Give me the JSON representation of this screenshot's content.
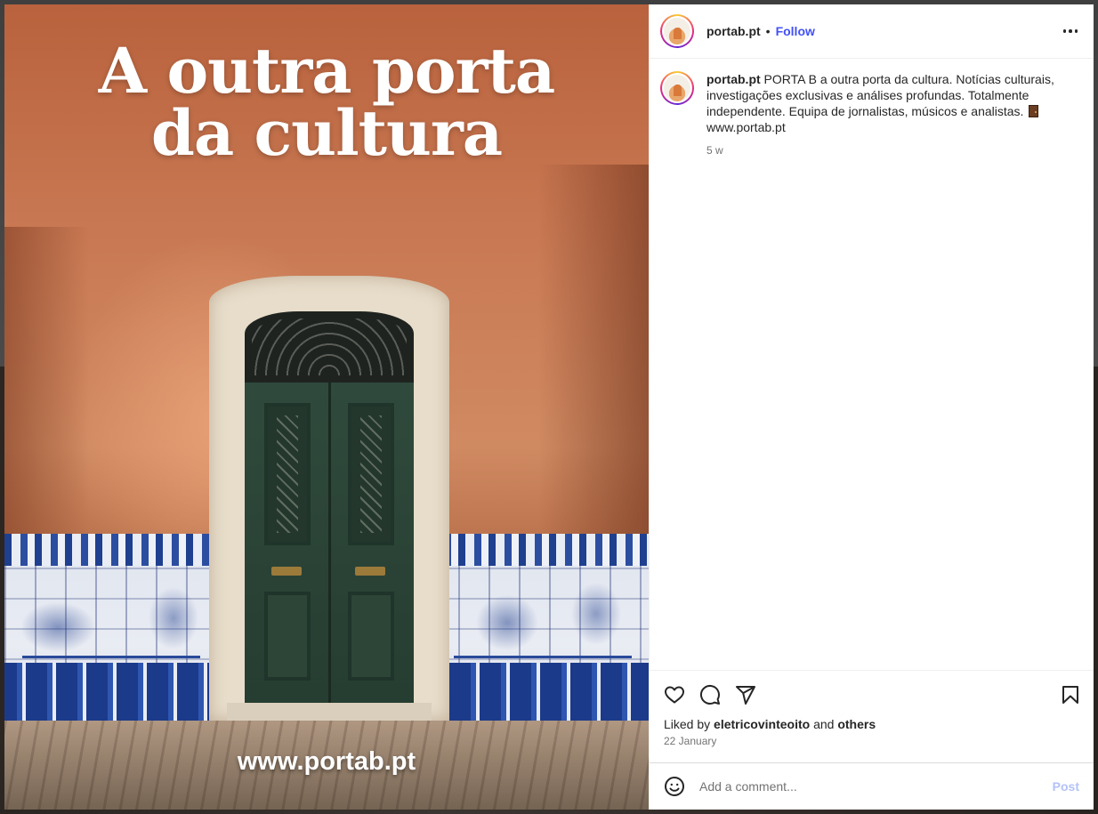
{
  "post": {
    "headline_line1": "A outra porta",
    "headline_line2": "da cultura",
    "image_url_text": "www.portab.pt"
  },
  "header": {
    "username": "portab.pt",
    "separator": "•",
    "follow_label": "Follow"
  },
  "caption": {
    "username": "portab.pt",
    "text": "PORTA B a outra porta da cultura. Notícias culturais, investigações exclusivas e análises profundas. Totalmente independente. Equipa de jornalistas, músicos e analistas.",
    "link": "www.portab.pt",
    "emoji": "door-icon",
    "time": "5 w"
  },
  "actions": {
    "icons": [
      "heart-icon",
      "comment-icon",
      "share-icon",
      "bookmark-icon"
    ],
    "liked_by_prefix": "Liked by",
    "liked_by_user": "eletricovinteoito",
    "liked_by_and": "and",
    "liked_by_others": "others",
    "date": "22 January"
  },
  "comment_box": {
    "placeholder": "Add a comment...",
    "post_label": "Post"
  },
  "colors": {
    "follow": "#4150f7",
    "post_disabled": "#b3c2f9",
    "secondary_text": "#737373"
  }
}
